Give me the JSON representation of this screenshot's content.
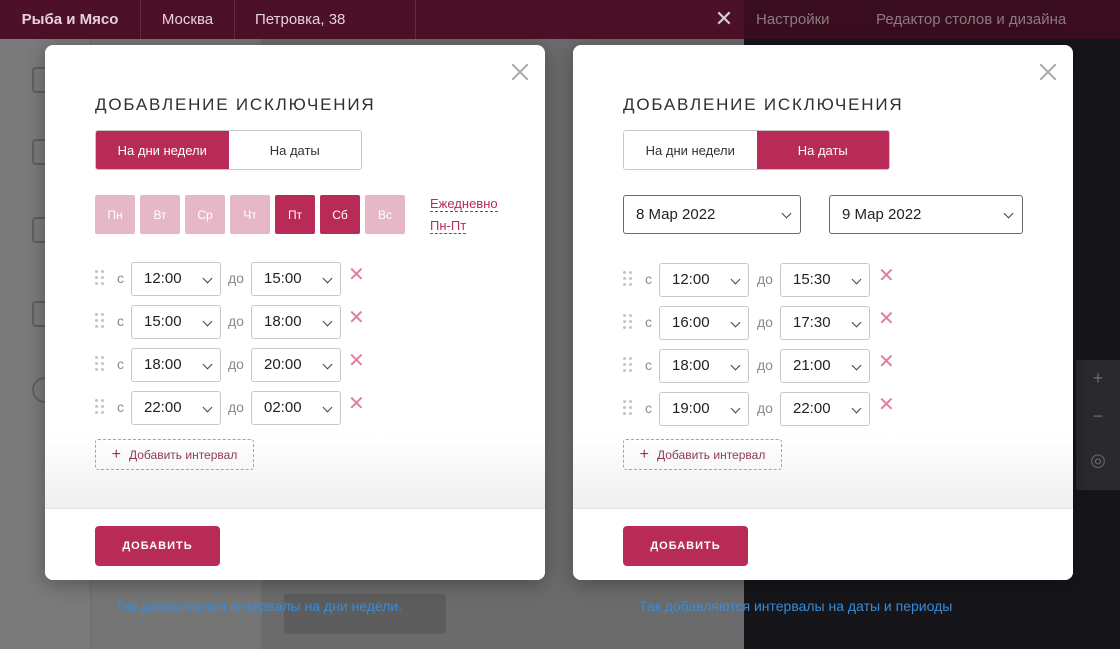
{
  "background": {
    "brand": "Рыба и Мясо",
    "city": "Москва",
    "address": "Петровка, 38",
    "settings": "Настройки",
    "editor": "Редактор столов и дизайна"
  },
  "modal_left": {
    "title": "Добавление исключения",
    "tabs": [
      {
        "label": "На дни недели",
        "active": true
      },
      {
        "label": "На даты",
        "active": false
      }
    ],
    "days": [
      {
        "label": "Пн",
        "selected": false
      },
      {
        "label": "Вт",
        "selected": false
      },
      {
        "label": "Ср",
        "selected": false
      },
      {
        "label": "Чт",
        "selected": false
      },
      {
        "label": "Пт",
        "selected": true
      },
      {
        "label": "Сб",
        "selected": true
      },
      {
        "label": "Вс",
        "selected": false
      }
    ],
    "quick_daily": "Ежедневно",
    "quick_weekdays": "Пн-Пт",
    "from_label": "с",
    "to_label": "до",
    "intervals": [
      {
        "from": "12:00",
        "to": "15:00"
      },
      {
        "from": "15:00",
        "to": "18:00"
      },
      {
        "from": "18:00",
        "to": "20:00"
      },
      {
        "from": "22:00",
        "to": "02:00"
      }
    ],
    "remove_glyph": "✕",
    "add_interval": "Добавить интервал",
    "submit": "ДОБАВИТЬ"
  },
  "modal_right": {
    "title": "Добавление исключения",
    "tabs": [
      {
        "label": "На дни недели",
        "active": false
      },
      {
        "label": "На даты",
        "active": true
      }
    ],
    "date_from": "8 Мар 2022",
    "date_to": "9 Мар 2022",
    "from_label": "с",
    "to_label": "до",
    "intervals": [
      {
        "from": "12:00",
        "to": "15:30"
      },
      {
        "from": "16:00",
        "to": "17:30"
      },
      {
        "from": "18:00",
        "to": "21:00"
      },
      {
        "from": "19:00",
        "to": "22:00"
      }
    ],
    "remove_glyph": "✕",
    "add_interval": "Добавить интервал",
    "submit": "ДОБАВИТЬ"
  },
  "captions": {
    "left": "Так добавляются интервалы на дни недели.",
    "right": "Так добавляются интервалы на даты и периоды"
  },
  "colors": {
    "accent": "#b82b57",
    "accent_light": "#e6b8c7",
    "caption": "#3a8bd6"
  }
}
